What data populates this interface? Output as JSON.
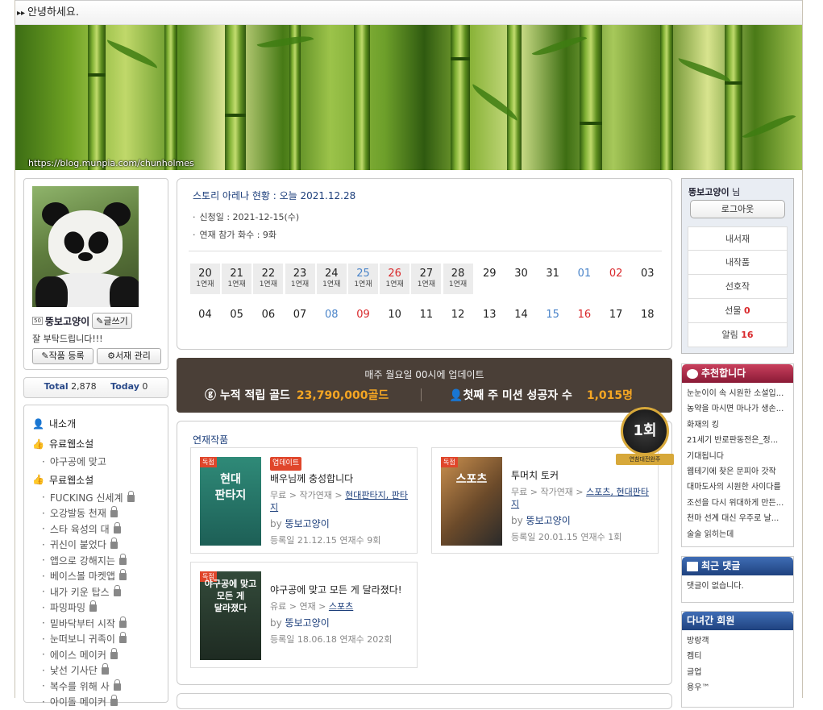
{
  "topbar": {
    "greeting": "안녕하세요."
  },
  "banner": {
    "url": "https://blog.munpia.com/chunholmes"
  },
  "profile": {
    "level": "50",
    "nickname": "뚱보고양이",
    "write_label": "글쓰기",
    "message": "잘 부탁드립니다!!!",
    "register_label": "작품 등록",
    "manage_label": "서재 관리"
  },
  "counter": {
    "total_label": "Total",
    "total": "2,878",
    "today_label": "Today",
    "today": "0"
  },
  "menu": {
    "intro": "내소개",
    "paid": "유료웹소설",
    "paid_items": [
      "야구공에 맞고"
    ],
    "free": "무료웹소설",
    "free_items": [
      "FUCKING 신세계",
      "오강발동 천재",
      "스타 육성의 대",
      "귀신이 붙었다",
      "앱으로 강해지는",
      "베이스볼 마켓앱",
      "내가 키운 탑스",
      "파밍파밍",
      "밑바닥부터 시작",
      "눈떠보니 귀족이",
      "에이스 메이커",
      "낯선 기사단",
      "복수를 위해 사",
      "아이돌 메이커"
    ]
  },
  "arena": {
    "title": "스토리 아레나 현황 : 오늘 2021.12.28",
    "apply_date": "신청일 : 2021-12-15(수)",
    "count_label": "연재 참가 화수 : ",
    "count_value": "9화",
    "row1": [
      {
        "n": "20",
        "s": "1연재",
        "c": ""
      },
      {
        "n": "21",
        "s": "1연재",
        "c": ""
      },
      {
        "n": "22",
        "s": "1연재",
        "c": ""
      },
      {
        "n": "23",
        "s": "1연재",
        "c": ""
      },
      {
        "n": "24",
        "s": "1연재",
        "c": ""
      },
      {
        "n": "25",
        "s": "1연재",
        "c": "b"
      },
      {
        "n": "26",
        "s": "1연재",
        "c": "r"
      },
      {
        "n": "27",
        "s": "1연재",
        "c": ""
      },
      {
        "n": "28",
        "s": "1연재",
        "c": ""
      },
      {
        "n": "29",
        "s": "",
        "c": ""
      },
      {
        "n": "30",
        "s": "",
        "c": ""
      },
      {
        "n": "31",
        "s": "",
        "c": ""
      },
      {
        "n": "01",
        "s": "",
        "c": "b"
      },
      {
        "n": "02",
        "s": "",
        "c": "r"
      },
      {
        "n": "03",
        "s": "",
        "c": ""
      }
    ],
    "row2": [
      {
        "n": "04",
        "c": ""
      },
      {
        "n": "05",
        "c": ""
      },
      {
        "n": "06",
        "c": ""
      },
      {
        "n": "07",
        "c": ""
      },
      {
        "n": "08",
        "c": "b"
      },
      {
        "n": "09",
        "c": "r"
      },
      {
        "n": "10",
        "c": ""
      },
      {
        "n": "11",
        "c": ""
      },
      {
        "n": "12",
        "c": ""
      },
      {
        "n": "13",
        "c": ""
      },
      {
        "n": "14",
        "c": ""
      },
      {
        "n": "15",
        "c": "b"
      },
      {
        "n": "16",
        "c": "r"
      },
      {
        "n": "17",
        "c": ""
      },
      {
        "n": "18",
        "c": ""
      }
    ]
  },
  "gold": {
    "notice": "매주 월요일 00시에 업데이트",
    "gold_label": "ⓖ 누적 적립 골드",
    "gold_value": "23,790,000골드",
    "winner_label": "첫째 주 미션 성공자 수",
    "winner_value": "1,015명",
    "medal_text": "1회",
    "medal_ribbon": "연참대전완주"
  },
  "works": {
    "title": "연재작품",
    "items": [
      {
        "cover_tag": "독점",
        "cover_title": "현대\n판타지",
        "badge": "업데이트",
        "name": "배우님께 충성합니다",
        "path": "무료 > 작가연재 > ",
        "genre": "현대판타지, 판타지",
        "by": "by ",
        "author": "뚱보고양이",
        "reg": "등록일 21.12.15 연재수 9회"
      },
      {
        "cover_tag": "독점",
        "cover_title": "스포츠",
        "badge": "",
        "name": "투머치 토커",
        "path": "무료 > 작가연재 > ",
        "genre": "스포츠, 현대판타지",
        "by": "by ",
        "author": "뚱보고양이",
        "reg": "등록일 20.01.15 연재수 1회"
      },
      {
        "cover_tag": "독점",
        "cover_title": "야구공에 맞고\n모든 게\n달라졌다",
        "badge": "",
        "name": "야구공에 맞고 모든 게 달라졌다!",
        "path": "유료 > 연재 > ",
        "genre": "스포츠",
        "by": "by ",
        "author": "뚱보고양이",
        "reg": "등록일 18.06.18 연재수 202회"
      }
    ]
  },
  "login": {
    "user": "뚱보고양이",
    "suffix": " 님",
    "logout": "로그아웃",
    "items": [
      {
        "label": "내서재",
        "count": ""
      },
      {
        "label": "내작품",
        "count": ""
      },
      {
        "label": "선호작",
        "count": ""
      },
      {
        "label": "선물 ",
        "count": "0"
      },
      {
        "label": "알림 ",
        "count": "16"
      }
    ]
  },
  "recommend": {
    "title": "추천합니다",
    "items": [
      "눈눈이이 속 시원한 소설입...",
      "농약을 마시면 마나가 생손...",
      "화재의 킹",
      "21세기 반로판동전은_정...",
      "기대됩니다",
      "웹테기에 찾은 문피아 갓작",
      "대마도사의 시원한 사이다를",
      "조선을 다시 위대하게 만든...",
      "천마 선계 대신 우주로 날...",
      "술술 읽히는데"
    ]
  },
  "comments": {
    "title": "최근 댓글",
    "empty": "댓글이 없습니다."
  },
  "visitors": {
    "title": "다녀간 회원",
    "items": [
      "방랑객",
      "켐티",
      "글업",
      "용우™"
    ]
  }
}
